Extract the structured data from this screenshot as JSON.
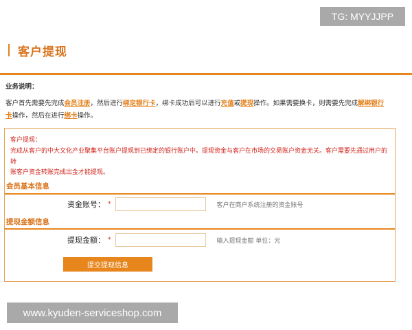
{
  "overlay": {
    "tg_label": "TG: MYYJJPP",
    "site_label": "www.kyuden-serviceshop.com"
  },
  "page": {
    "title": "客户提现"
  },
  "notice": {
    "heading": "业务说明：",
    "line1_a": "客户首先需要先完成",
    "link_register": "会员注册",
    "line1_b": "，然后进行",
    "link_bind": "绑定银行卡",
    "line1_c": "，绑卡成功后可以进行",
    "link_deposit": "充值",
    "line1_d": "或",
    "link_withdraw": "提现",
    "line1_e": "操作。如果需要换卡，则需要先完成",
    "link_unbind_1": "解绑银行",
    "link_unbind_2": "卡",
    "line2_a": "操作，然后在进行",
    "link_rebind": "绑卡",
    "line2_b": "操作。"
  },
  "warning": {
    "title": "客户提现：",
    "line1": "完成从客户的中大文化产业聚集平台账户提现到已绑定的银行账户中。提现资金与客户在市场的交易账户资金无关。客户需要先通过用户的转",
    "line2": "账客户资金转账完成出金才能提现。"
  },
  "member_section": {
    "title": "会员基本信息",
    "account_label": "资金账号：",
    "required_mark": "*",
    "account_value": "",
    "account_hint": "客户在商户系统注册的资金账号"
  },
  "amount_section": {
    "title": "提现金额信息",
    "amount_label": "提现金额：",
    "required_mark": "*",
    "amount_value": "",
    "amount_hint": "输入提现金额  单位：元"
  },
  "actions": {
    "submit_label": "提交提现信息"
  },
  "colors": {
    "accent": "#e8861e",
    "warning": "#d0241c"
  }
}
